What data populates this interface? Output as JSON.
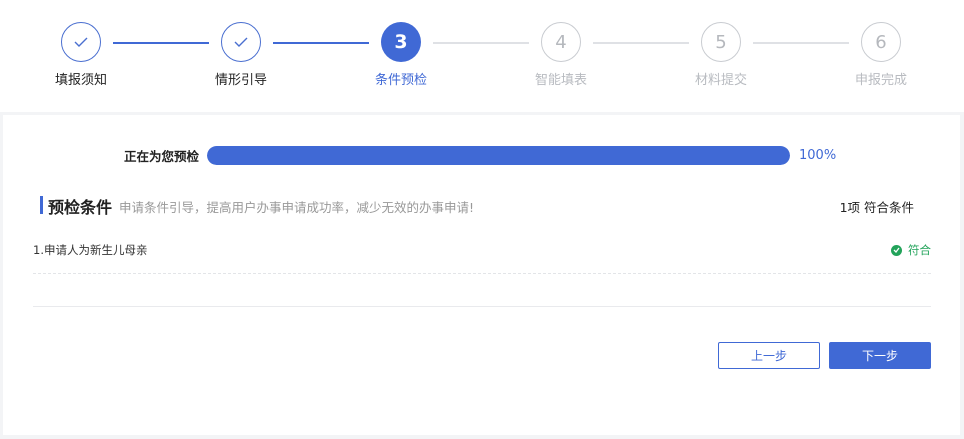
{
  "steps": [
    {
      "number": "1",
      "label": "填报须知",
      "state": "done"
    },
    {
      "number": "2",
      "label": "情形引导",
      "state": "done"
    },
    {
      "number": "3",
      "label": "条件预检",
      "state": "active"
    },
    {
      "number": "4",
      "label": "智能填表",
      "state": "todo"
    },
    {
      "number": "5",
      "label": "材料提交",
      "state": "todo"
    },
    {
      "number": "6",
      "label": "申报完成",
      "state": "todo"
    }
  ],
  "progress": {
    "label": "正在为您预检",
    "percent_text": "100%",
    "value": 1.0
  },
  "section": {
    "title": "预检条件",
    "subtitle": "申请条件引导，提高用户办事申请成功率，减少无效的办事申请!",
    "count_text": "1项 符合条件"
  },
  "conditions": [
    {
      "text": "1.申请人为新生儿母亲",
      "status": "符合"
    }
  ],
  "buttons": {
    "prev": "上一步",
    "next": "下一步"
  },
  "colors": {
    "accent": "#4069d5",
    "success": "#22a35a",
    "inactive": "#b8bbc0"
  }
}
